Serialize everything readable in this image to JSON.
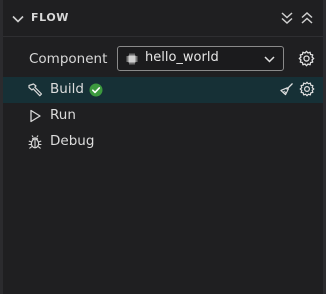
{
  "panel": {
    "title": "FLOW",
    "collapse_icon": "chevron-down-icon",
    "collapse_all_icon": "double-chevron-down-icon",
    "expand_all_icon": "double-chevron-up-icon"
  },
  "component": {
    "label": "Component",
    "selected": "hello_world",
    "chip_icon": "chip-icon",
    "dropdown_icon": "chevron-down-icon",
    "settings_icon": "gear-icon"
  },
  "items": [
    {
      "label": "Build",
      "icon": "hammer-icon",
      "status": "success",
      "status_icon": "check-circle-icon",
      "active": true,
      "actions": [
        "broom-icon",
        "gear-icon"
      ]
    },
    {
      "label": "Run",
      "icon": "play-outline-icon"
    },
    {
      "label": "Debug",
      "icon": "bug-icon"
    }
  ],
  "colors": {
    "background": "#1f1f21",
    "active_row": "#163036",
    "success": "#3c9a3e",
    "text": "#d8d8d8"
  }
}
